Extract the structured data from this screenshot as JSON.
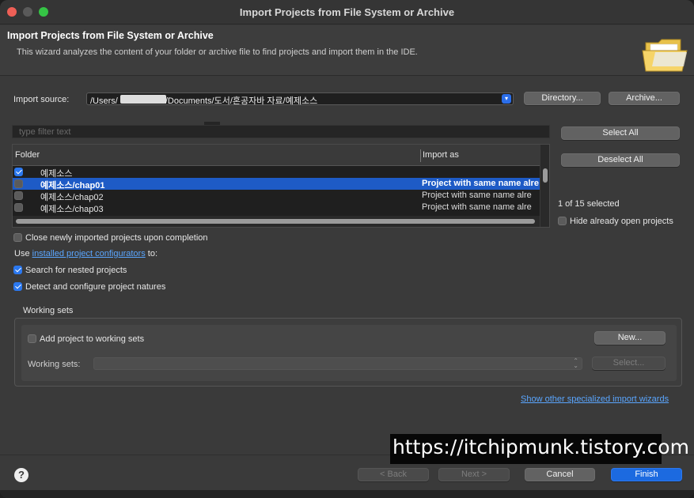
{
  "window": {
    "title": "Import Projects from File System or Archive"
  },
  "banner": {
    "title": "Import Projects from File System or Archive",
    "description": "This wizard analyzes the content of your folder or archive file to find projects and import them in the IDE."
  },
  "import_source": {
    "label": "Import source:",
    "value_prefix": "/Users/",
    "value_suffix": "/Documents/도서/혼공자바 자료/예제소스",
    "directory_button": "Directory...",
    "archive_button": "Archive..."
  },
  "filter": {
    "placeholder": "type filter text"
  },
  "table": {
    "columns": [
      "Folder",
      "Import as"
    ],
    "rows": [
      {
        "folder": "예제소스",
        "import_as": "",
        "checked": true,
        "selected": false
      },
      {
        "folder": "예제소스/chap01",
        "import_as": "Project with same name alre",
        "checked": false,
        "selected": true
      },
      {
        "folder": "예제소스/chap02",
        "import_as": "Project with same name alre",
        "checked": false,
        "selected": false
      },
      {
        "folder": "예제소스/chap03",
        "import_as": "Project with same name alre",
        "checked": false,
        "selected": false
      }
    ]
  },
  "side": {
    "select_all": "Select All",
    "deselect_all": "Deselect All",
    "selection_count": "1 of 15 selected",
    "hide_open": "Hide already open projects"
  },
  "options": {
    "close_imported": "Close newly imported projects upon completion",
    "use_prefix": "Use",
    "configurators_link": "installed project configurators",
    "use_suffix": "to:",
    "search_nested": "Search for nested projects",
    "detect_natures": "Detect and configure project natures"
  },
  "working_sets": {
    "group_label": "Working sets",
    "add_label": "Add project to working sets",
    "new_button": "New...",
    "sets_label": "Working sets:",
    "select_button": "Select..."
  },
  "other_wizards_link": "Show other specialized import wizards",
  "footer": {
    "back": "< Back",
    "next": "Next >",
    "cancel": "Cancel",
    "finish": "Finish"
  },
  "watermark": "https://itchipmunk.tistory.com"
}
